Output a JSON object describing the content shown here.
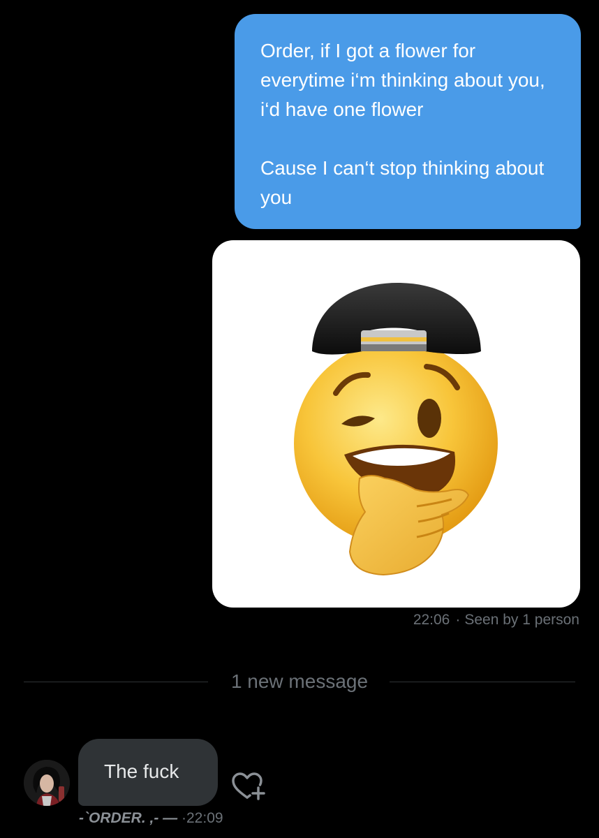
{
  "conversation": {
    "outgoing": {
      "paragraph_1": "Order, if I got a flower for everytime i‘m thinking about you, i‘d have one flower",
      "paragraph_2": "Cause I can‘t stop thinking about you",
      "time": "22:06",
      "separator": "·",
      "status": "Seen by 1 person"
    },
    "media": {
      "icon": "thinking-emoji-with-cap-sticker"
    },
    "divider": {
      "label": "1 new message"
    },
    "incoming": {
      "text": "The fuck",
      "sender": "-`ORDER. ,- —",
      "separator": "·",
      "time": "22:09",
      "reaction_icon": "heart-plus-icon"
    }
  },
  "colors": {
    "background": "#000000",
    "outgoing_bubble": "#4a9be8",
    "incoming_bubble": "#2f3336",
    "meta_text": "#6b7177"
  }
}
